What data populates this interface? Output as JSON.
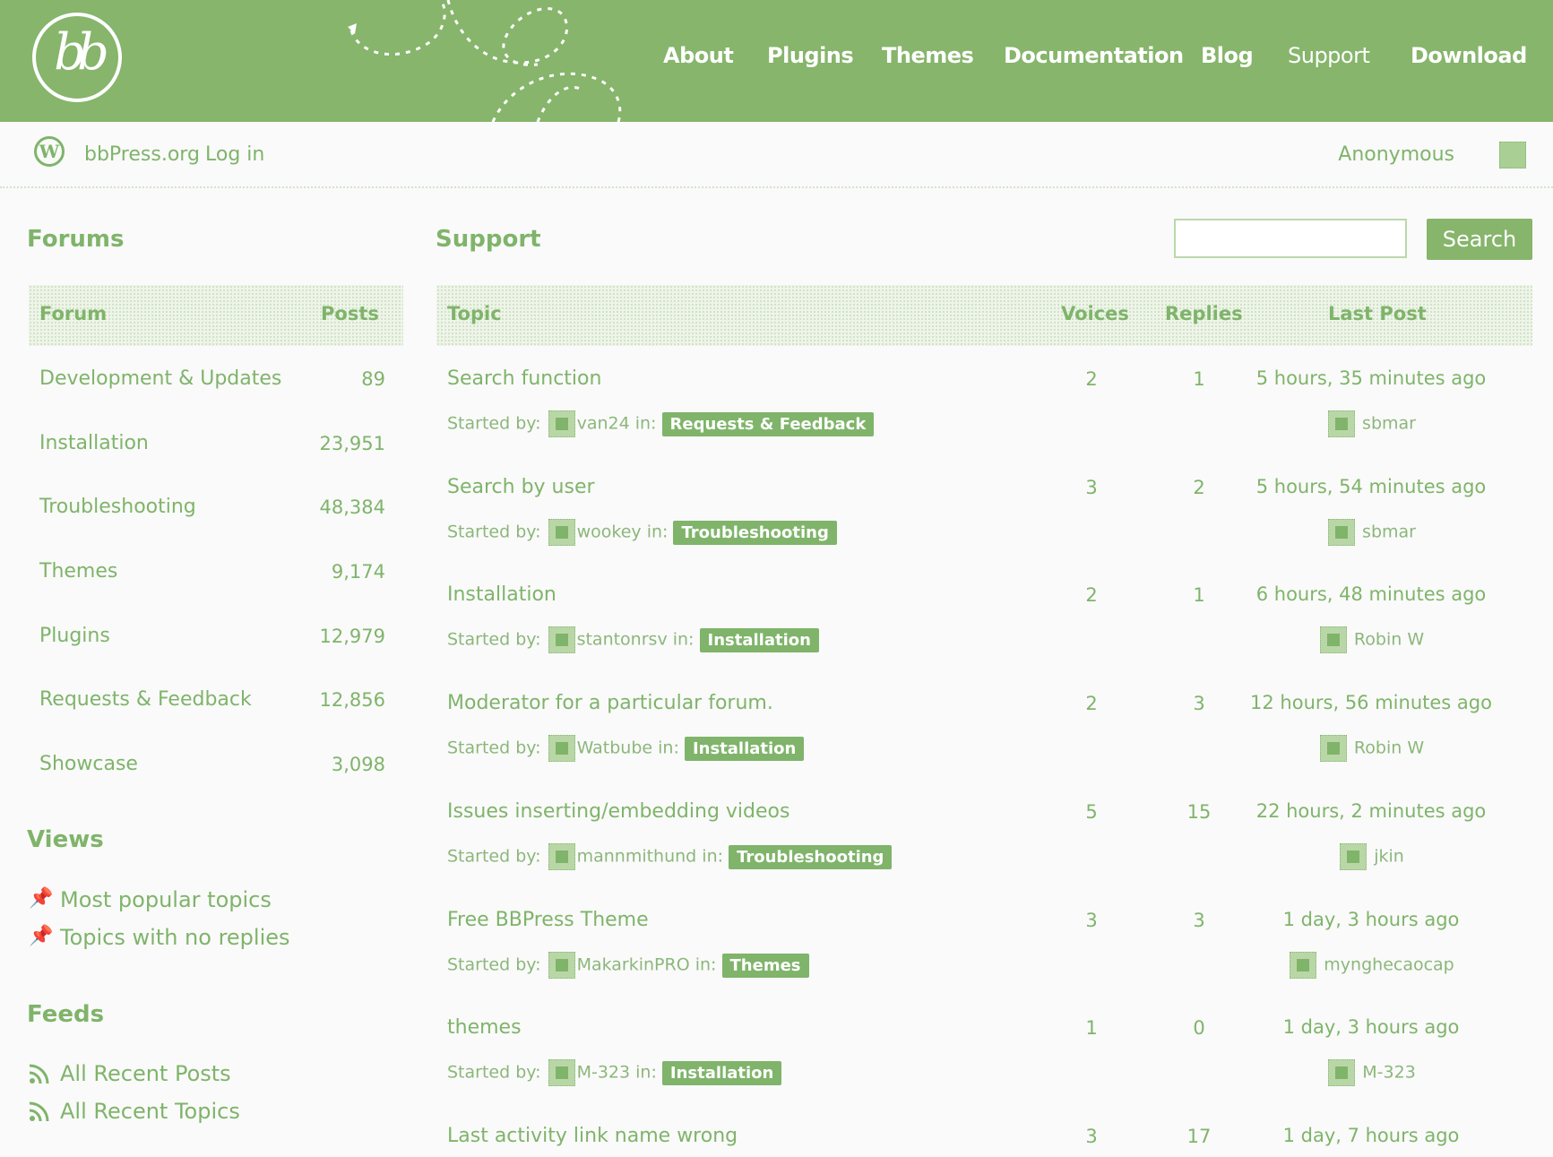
{
  "header": {
    "logo_text": "bb",
    "nav": [
      "About",
      "Plugins",
      "Themes",
      "Documentation",
      "Blog",
      "Support",
      "Download"
    ]
  },
  "subbar": {
    "site_link": "bbPress.org",
    "login_link": "Log in",
    "user": "Anonymous"
  },
  "sidebar": {
    "forums_title": "Forums",
    "col_forum": "Forum",
    "col_posts": "Posts",
    "forums": [
      {
        "name": "Development & Updates",
        "posts": "89"
      },
      {
        "name": "Installation",
        "posts": "23,951"
      },
      {
        "name": "Troubleshooting",
        "posts": "48,384"
      },
      {
        "name": "Themes",
        "posts": "9,174"
      },
      {
        "name": "Plugins",
        "posts": "12,979"
      },
      {
        "name": "Requests & Feedback",
        "posts": "12,856"
      },
      {
        "name": "Showcase",
        "posts": "3,098"
      }
    ],
    "views_title": "Views",
    "views": [
      "Most popular topics",
      "Topics with no replies"
    ],
    "feeds_title": "Feeds",
    "feeds": [
      "All Recent Posts",
      "All Recent Topics"
    ]
  },
  "main": {
    "title": "Support",
    "search_button": "Search",
    "search_value": "",
    "col_topic": "Topic",
    "col_voices": "Voices",
    "col_replies": "Replies",
    "col_last": "Last Post",
    "started_by": "Started by:",
    "in_label": "in:",
    "topics": [
      {
        "title": "Search function",
        "author": "van24",
        "forum": "Requests & Feedback",
        "voices": "2",
        "replies": "1",
        "last": "5 hours, 35 minutes ago",
        "last_user": "sbmar"
      },
      {
        "title": "Search by user",
        "author": "wookey",
        "forum": "Troubleshooting",
        "voices": "3",
        "replies": "2",
        "last": "5 hours, 54 minutes ago",
        "last_user": "sbmar"
      },
      {
        "title": "Installation",
        "author": "stantonrsv",
        "forum": "Installation",
        "voices": "2",
        "replies": "1",
        "last": "6 hours, 48 minutes ago",
        "last_user": "Robin W"
      },
      {
        "title": "Moderator for a particular forum.",
        "author": "Watbube",
        "forum": "Installation",
        "voices": "2",
        "replies": "3",
        "last": "12 hours, 56 minutes ago",
        "last_user": "Robin W"
      },
      {
        "title": "Issues inserting/embedding videos",
        "author": "mannmithund",
        "forum": "Troubleshooting",
        "voices": "5",
        "replies": "15",
        "last": "22 hours, 2 minutes ago",
        "last_user": "jkin"
      },
      {
        "title": "Free BBPress Theme",
        "author": "MakarkinPRO",
        "forum": "Themes",
        "voices": "3",
        "replies": "3",
        "last": "1 day, 3 hours ago",
        "last_user": "mynghecaocap"
      },
      {
        "title": "themes",
        "author": "M-323",
        "forum": "Installation",
        "voices": "1",
        "replies": "0",
        "last": "1 day, 3 hours ago",
        "last_user": "M-323"
      },
      {
        "title": "Last activity link name wrong",
        "author": "",
        "forum": "",
        "voices": "3",
        "replies": "17",
        "last": "1 day, 7 hours ago",
        "last_user": ""
      }
    ]
  }
}
